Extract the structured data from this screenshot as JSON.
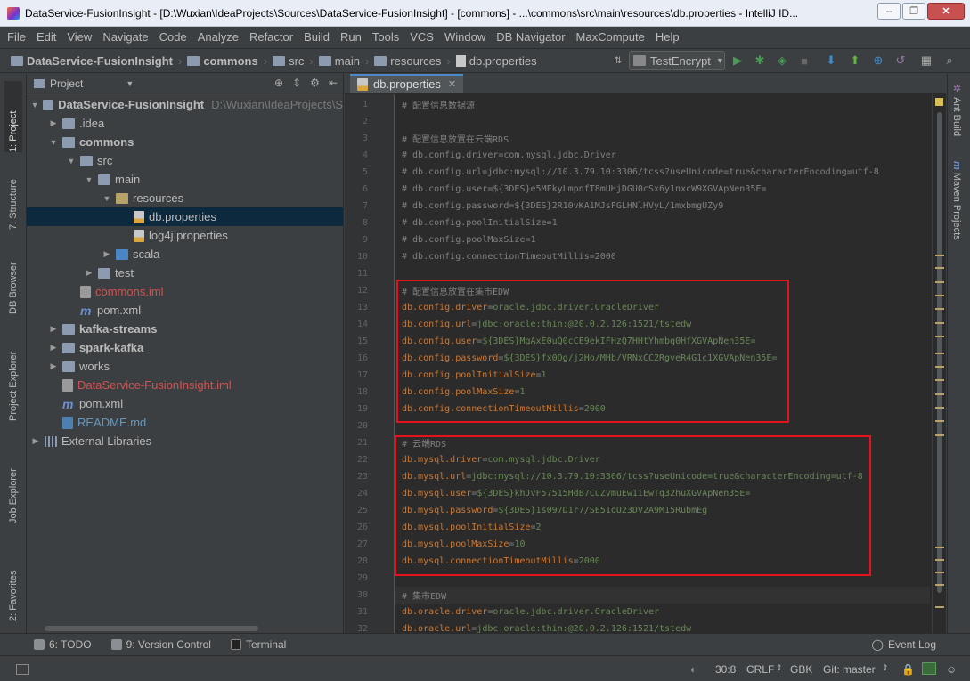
{
  "window": {
    "title": "DataService-FusionInsight - [D:\\Wuxian\\IdeaProjects\\Sources\\DataService-FusionInsight] - [commons] - ...\\commons\\src\\main\\resources\\db.properties - IntelliJ ID...",
    "minimize": "–",
    "maximize": "❐",
    "close": "✕"
  },
  "menu": [
    "File",
    "Edit",
    "View",
    "Navigate",
    "Code",
    "Analyze",
    "Refactor",
    "Build",
    "Run",
    "Tools",
    "VCS",
    "Window",
    "DB Navigator",
    "MaxCompute",
    "Help"
  ],
  "breadcrumbs": [
    "DataService-FusionInsight",
    "commons",
    "src",
    "main",
    "resources",
    "db.properties"
  ],
  "run_config": "TestEncrypt",
  "toolbar_icons": [
    "run-icon",
    "debug-icon",
    "coverage-icon",
    "stop-icon",
    "vcs-update-icon",
    "vcs-commit-icon",
    "compare-icon",
    "revert-icon",
    "project-structure-icon",
    "search-icon"
  ],
  "left_stripe": {
    "project": "1: Project",
    "structure": "7: Structure",
    "db_browser": "DB Browser",
    "project_explorer": "Project Explorer",
    "job_explorer": "Job Explorer",
    "favorites": "2: Favorites"
  },
  "right_stripe": {
    "ant": "Ant Build",
    "maven": "Maven Projects"
  },
  "project_panel": {
    "title": "Project",
    "tree": [
      {
        "label": "DataService-FusionInsight",
        "extra": "D:\\Wuxian\\IdeaProjects\\S",
        "depth": 0,
        "arrow": "down",
        "icon": "folder",
        "style": "bold"
      },
      {
        "label": ".idea",
        "depth": 1,
        "arrow": "right",
        "icon": "folder"
      },
      {
        "label": "commons",
        "depth": 1,
        "arrow": "down",
        "icon": "folder",
        "style": "bold"
      },
      {
        "label": "src",
        "depth": 2,
        "arrow": "down",
        "icon": "folder"
      },
      {
        "label": "main",
        "depth": 3,
        "arrow": "down",
        "icon": "folder"
      },
      {
        "label": "resources",
        "depth": 4,
        "arrow": "down",
        "icon": "res"
      },
      {
        "label": "db.properties",
        "depth": 5,
        "arrow": "",
        "icon": "props",
        "selected": true
      },
      {
        "label": "log4j.properties",
        "depth": 5,
        "arrow": "",
        "icon": "props"
      },
      {
        "label": "scala",
        "depth": 4,
        "arrow": "right",
        "icon": "blue"
      },
      {
        "label": "test",
        "depth": 3,
        "arrow": "right",
        "icon": "folder"
      },
      {
        "label": "commons.iml",
        "depth": 2,
        "arrow": "",
        "icon": "iml",
        "style": "red"
      },
      {
        "label": "pom.xml",
        "depth": 2,
        "arrow": "",
        "icon": "maven"
      },
      {
        "label": "kafka-streams",
        "depth": 1,
        "arrow": "right",
        "icon": "folder",
        "style": "bold"
      },
      {
        "label": "spark-kafka",
        "depth": 1,
        "arrow": "right",
        "icon": "folder",
        "style": "bold"
      },
      {
        "label": "works",
        "depth": 1,
        "arrow": "right",
        "icon": "folder"
      },
      {
        "label": "DataService-FusionInsight.iml",
        "depth": 1,
        "arrow": "",
        "icon": "iml",
        "style": "red"
      },
      {
        "label": "pom.xml",
        "depth": 1,
        "arrow": "",
        "icon": "maven"
      },
      {
        "label": "README.md",
        "depth": 1,
        "arrow": "",
        "icon": "md",
        "style": "blue"
      },
      {
        "label": "External Libraries",
        "depth": 0,
        "arrow": "right",
        "icon": "lib"
      }
    ]
  },
  "editor": {
    "tab": "db.properties",
    "lines": [
      {
        "n": "1",
        "text": "# 配置信息数据源",
        "kind": "comment"
      },
      {
        "n": "2",
        "text": "",
        "kind": "comment"
      },
      {
        "n": "3",
        "text": "# 配置信息放置在云端RDS",
        "kind": "comment"
      },
      {
        "n": "4",
        "text": "# db.config.driver=com.mysql.jdbc.Driver",
        "kind": "comment"
      },
      {
        "n": "5",
        "text": "# db.config.url=jdbc:mysql://10.3.79.10:3306/tcss?useUnicode=true&characterEncoding=utf-8",
        "kind": "comment"
      },
      {
        "n": "6",
        "text": "# db.config.user=${3DES}e5MFkyLmpnfT8mUHjDGU0cSx6y1nxcW9XGVApNen35E=",
        "kind": "comment"
      },
      {
        "n": "7",
        "text": "# db.config.password=${3DES}2R10vKA1MJsFGLHNlHVyL/1mxbmgUZy9",
        "kind": "comment"
      },
      {
        "n": "8",
        "text": "# db.config.poolInitialSize=1",
        "kind": "comment"
      },
      {
        "n": "9",
        "text": "# db.config.poolMaxSize=1",
        "kind": "comment"
      },
      {
        "n": "10",
        "text": "# db.config.connectionTimeoutMillis=2000",
        "kind": "comment"
      },
      {
        "n": "11",
        "text": "",
        "kind": "comment"
      },
      {
        "n": "12",
        "text": "# 配置信息放置在集市EDW",
        "kind": "comment"
      },
      {
        "n": "13",
        "key": "db.config.driver",
        "val": "oracle.jdbc.driver.OracleDriver",
        "kind": "prop"
      },
      {
        "n": "14",
        "key": "db.config.url",
        "val": "jdbc:oracle:thin:@20.0.2.126:1521/tstedw",
        "kind": "prop"
      },
      {
        "n": "15",
        "key": "db.config.user",
        "val": "${3DES}MgAxE0uQ0cCE9ekIFHzQ7HHtYhmbq0HfXGVApNen35E=",
        "kind": "prop"
      },
      {
        "n": "16",
        "key": "db.config.password",
        "val": "${3DES}fx0Dg/j2Ho/MHb/VRNxCC2RgveR4G1c1XGVApNen35E=",
        "kind": "prop"
      },
      {
        "n": "17",
        "key": "db.config.poolInitialSize",
        "val": "1",
        "kind": "prop"
      },
      {
        "n": "18",
        "key": "db.config.poolMaxSize",
        "val": "1",
        "kind": "prop"
      },
      {
        "n": "19",
        "key": "db.config.connectionTimeoutMillis",
        "val": "2000",
        "kind": "prop"
      },
      {
        "n": "20",
        "text": "",
        "kind": "comment"
      },
      {
        "n": "21",
        "text": "# 云端RDS",
        "kind": "comment"
      },
      {
        "n": "22",
        "key": "db.mysql.driver",
        "val": "com.mysql.jdbc.Driver",
        "kind": "prop"
      },
      {
        "n": "23",
        "key": "db.mysql.url",
        "val": "jdbc:mysql://10.3.79.10:3306/tcss?useUnicode=true&characterEncoding=utf-8",
        "kind": "prop"
      },
      {
        "n": "24",
        "key": "db.mysql.user",
        "val": "${3DES}khJvF57515HdB7CuZvmuEw1iEwTq32huXGVApNen35E=",
        "kind": "prop"
      },
      {
        "n": "25",
        "key": "db.mysql.password",
        "val": "${3DES}1s097D1r7/SE51oU23DV2A9M15RubmEg",
        "kind": "prop"
      },
      {
        "n": "26",
        "key": "db.mysql.poolInitialSize",
        "val": "2",
        "kind": "prop"
      },
      {
        "n": "27",
        "key": "db.mysql.poolMaxSize",
        "val": "10",
        "kind": "prop"
      },
      {
        "n": "28",
        "key": "db.mysql.connectionTimeoutMillis",
        "val": "2000",
        "kind": "prop"
      },
      {
        "n": "29",
        "text": "",
        "kind": "comment"
      },
      {
        "n": "30",
        "text": "# 集市EDW",
        "kind": "comment",
        "caret": true
      },
      {
        "n": "31",
        "key": "db.oracle.driver",
        "val": "oracle.jdbc.driver.OracleDriver",
        "kind": "prop"
      },
      {
        "n": "32",
        "key": "db.oracle.url",
        "val": "jdbc:oracle:thin:@20.0.2.126:1521/tstedw",
        "kind": "prop"
      }
    ]
  },
  "bottom_tools": {
    "todo": "6: TODO",
    "version_control": "9: Version Control",
    "terminal": "Terminal",
    "event_log": "Event Log"
  },
  "status": {
    "position": "30:8",
    "line_sep": "CRLF",
    "encoding": "GBK",
    "git": "Git: master"
  },
  "colors": {
    "highlight_box": "#e8111b",
    "selection": "#0d293e",
    "accent": "#4a88c7"
  }
}
